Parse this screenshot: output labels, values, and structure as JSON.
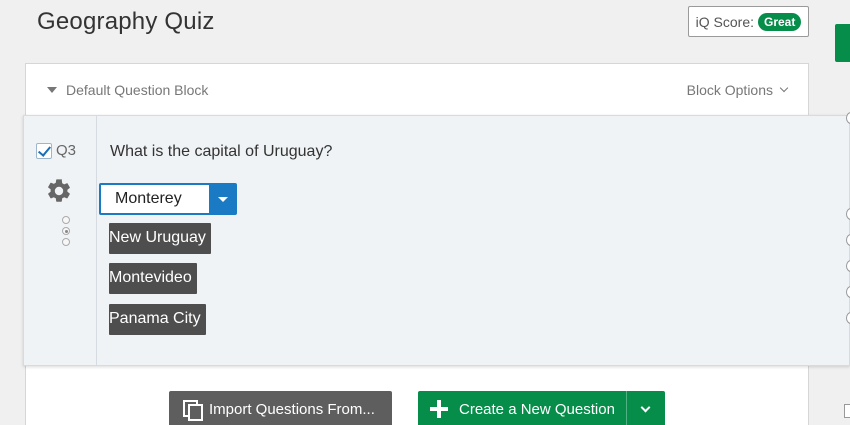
{
  "survey": {
    "title": "Geography Quiz"
  },
  "iq_score": {
    "label": "iQ Score:",
    "value": "Great",
    "badge_color": "#078d4a"
  },
  "block": {
    "title": "Default Question Block",
    "options_label": "Block Options"
  },
  "question": {
    "number": "Q3",
    "checked": true,
    "text": "What is the capital of Uruguay?",
    "selected_value": "Monterey",
    "options": [
      "New Uruguay",
      "Montevideo",
      "Panama City"
    ]
  },
  "actions": {
    "import_label": "Import Questions From...",
    "create_label": "Create a New Question"
  },
  "colors": {
    "accent_blue": "#1a7ac4",
    "accent_green": "#078d4a",
    "choice_bg": "#4e4e4e"
  },
  "icons": [
    "caret-down-icon",
    "chevron-down-icon",
    "checkbox-icon",
    "gear-icon",
    "copy-icon",
    "plus-icon"
  ]
}
